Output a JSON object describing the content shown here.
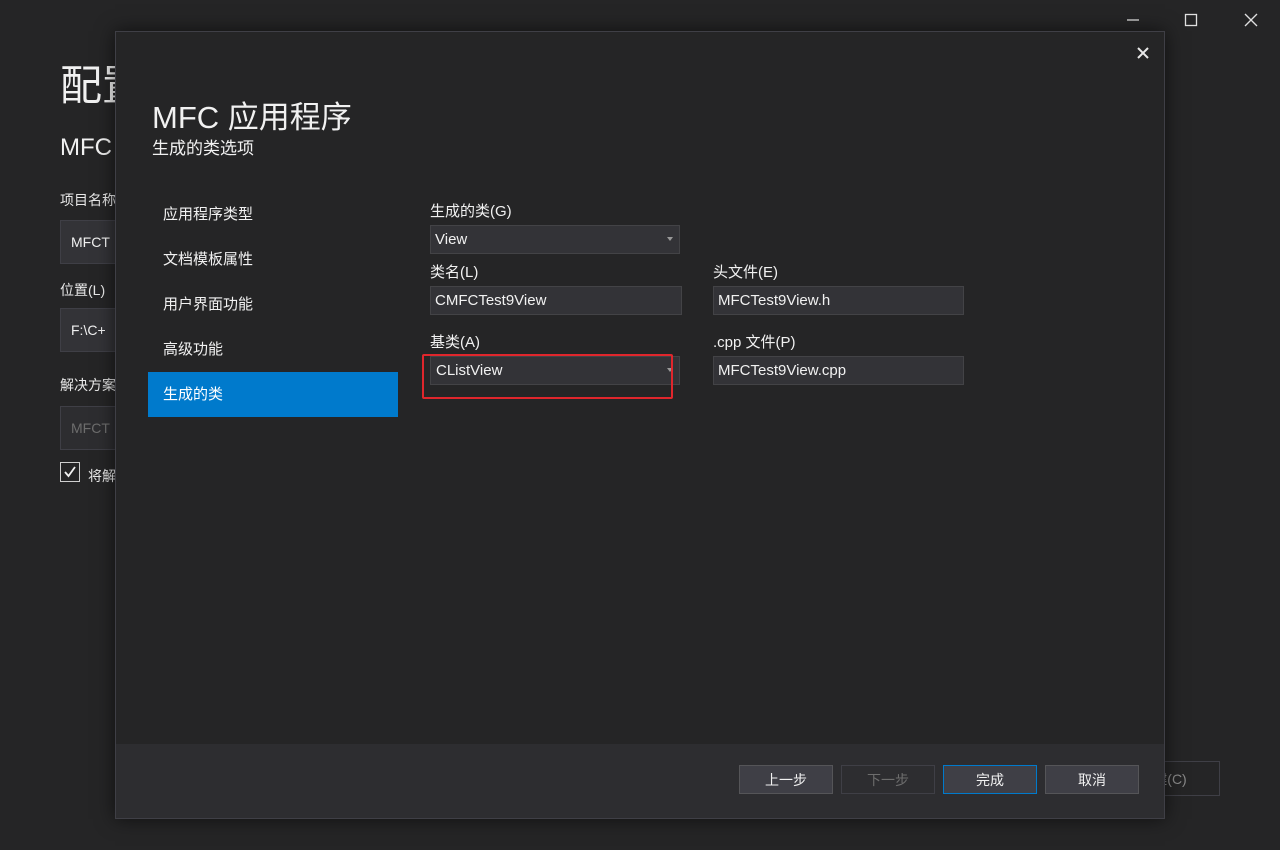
{
  "background": {
    "title": "配置",
    "subtitle": "MFC",
    "project_name_label": "项目名称",
    "project_name_value": "MFCT",
    "location_label": "位置(L)",
    "location_value": "F:\\C+",
    "solution_label": "解决方案",
    "solution_value": "MFCT",
    "checkbox_label": "将解",
    "create_button_label": "建(C)"
  },
  "dialog": {
    "title": "MFC 应用程序",
    "subtitle": "生成的类选项",
    "nav": [
      {
        "label": "应用程序类型",
        "active": false
      },
      {
        "label": "文档模板属性",
        "active": false
      },
      {
        "label": "用户界面功能",
        "active": false
      },
      {
        "label": "高级功能",
        "active": false
      },
      {
        "label": "生成的类",
        "active": true
      }
    ],
    "form": {
      "generated_class_label": "生成的类(G)",
      "generated_class_value": "View",
      "class_name_label": "类名(L)",
      "class_name_value": "CMFCTest9View",
      "header_file_label": "头文件(E)",
      "header_file_value": "MFCTest9View.h",
      "base_class_label": "基类(A)",
      "base_class_value": "CListView",
      "cpp_file_label": ".cpp 文件(P)",
      "cpp_file_value": "MFCTest9View.cpp"
    },
    "buttons": {
      "prev": "上一步",
      "next": "下一步",
      "finish": "完成",
      "cancel": "取消"
    }
  },
  "colors": {
    "accent": "#007acc",
    "highlight_box": "#e0262c",
    "background": "#252526"
  }
}
